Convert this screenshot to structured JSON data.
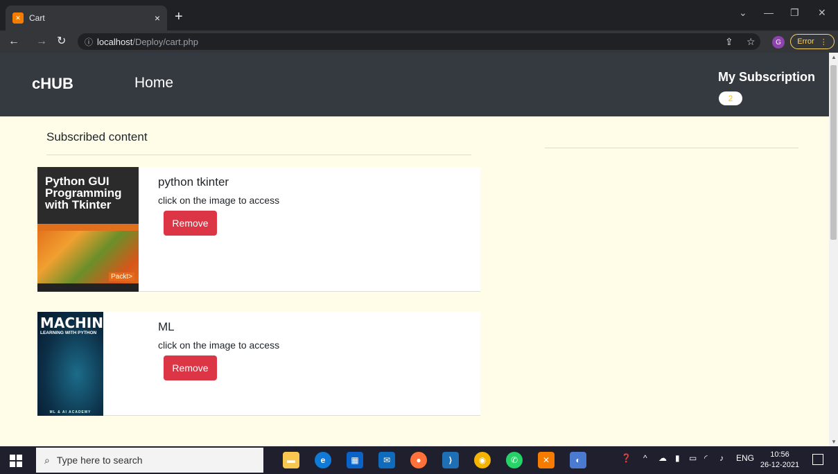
{
  "browser": {
    "tab_title": "Cart",
    "tab_close": "×",
    "new_tab": "+",
    "url_host": "localhost",
    "url_path": "/Deploy/cart.php",
    "profile_initial": "G",
    "error_label": "Error",
    "icons": [
      "back-icon",
      "forward-icon",
      "reload-icon",
      "info-icon",
      "share-icon",
      "star-icon",
      "menu-icon"
    ]
  },
  "nav": {
    "brand": "cHUB",
    "home": "Home",
    "my_subscription": "My Subscription",
    "count": "2"
  },
  "main": {
    "section_title": "Subscribed content",
    "items": [
      {
        "name": "python tkinter",
        "hint": "click on the image to access",
        "remove_label": "Remove",
        "cover_title": "Python GUI Programming with Tkinter",
        "cover_publisher": "Packt>"
      },
      {
        "name": "ML",
        "hint": "click on the image to access",
        "remove_label": "Remove",
        "cover_title": "MACHINE",
        "cover_subtitle": "LEARNING WITH PYTHON",
        "cover_footer": "ML & AI ACADEMY"
      }
    ]
  },
  "taskbar": {
    "search_placeholder": "Type here to search",
    "lang": "ENG",
    "time": "10:56",
    "date": "26-12-2021"
  }
}
